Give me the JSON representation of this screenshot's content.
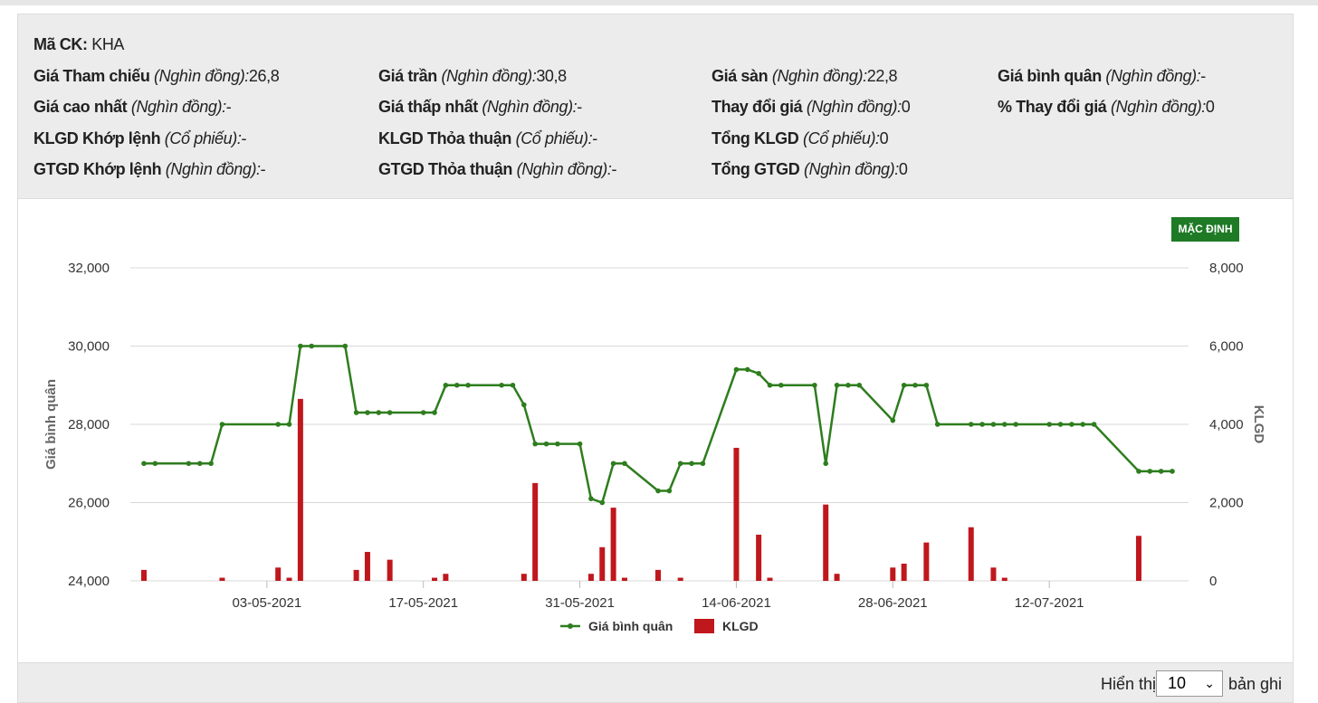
{
  "info": {
    "ticker_label": "Mã CK:",
    "ticker": "KHA",
    "rows": [
      [
        {
          "label": "Giá Tham chiếu",
          "unit": "(Nghìn đồng):",
          "value": "26,8"
        },
        {
          "label": "Giá trần",
          "unit": "(Nghìn đồng):",
          "value": "30,8"
        },
        {
          "label": "Giá sàn",
          "unit": "(Nghìn đồng):",
          "value": "22,8"
        },
        {
          "label": "Giá bình quân",
          "unit": "(Nghìn đồng):",
          "value": "-"
        }
      ],
      [
        {
          "label": "Giá cao nhất",
          "unit": "(Nghìn đồng):",
          "value": "-"
        },
        {
          "label": "Giá thấp nhất",
          "unit": "(Nghìn đồng):",
          "value": "-"
        },
        {
          "label": "Thay đổi giá",
          "unit": "(Nghìn đồng):",
          "value": "0"
        },
        {
          "label": "% Thay đổi giá",
          "unit": "(Nghìn đồng):",
          "value": "0"
        }
      ],
      [
        {
          "label": "KLGD Khớp lệnh",
          "unit": "(Cổ phiếu):",
          "value": "-"
        },
        {
          "label": "KLGD Thỏa thuận",
          "unit": "(Cổ phiếu):",
          "value": "-"
        },
        {
          "label": "Tổng KLGD",
          "unit": "(Cổ phiếu):",
          "value": "0"
        }
      ],
      [
        {
          "label": "GTGD Khớp lệnh",
          "unit": "(Nghìn đồng):",
          "value": "-"
        },
        {
          "label": "GTGD Thỏa thuận",
          "unit": "(Nghìn đồng):",
          "value": "-"
        },
        {
          "label": "Tổng GTGD",
          "unit": "(Nghìn đồng):",
          "value": "0"
        }
      ]
    ]
  },
  "default_button": "MẶC ĐỊNH",
  "footer": {
    "show_label": "Hiển thị",
    "page_size": "10",
    "records_label": "bản ghi"
  },
  "chart_data": {
    "type": "line+bar",
    "ylabel_left": "Giá bình quân",
    "ylabel_right": "KLGD",
    "y_left_range": [
      24000,
      32000
    ],
    "y_left_ticks": [
      "24,000",
      "26,000",
      "28,000",
      "30,000",
      "32,000"
    ],
    "y_right_range": [
      0,
      8000
    ],
    "y_right_ticks": [
      "0",
      "2,000",
      "4,000",
      "6,000",
      "8,000"
    ],
    "x_tick_labels": [
      {
        "index": 11,
        "label": "03-05-2021"
      },
      {
        "index": 25,
        "label": "17-05-2021"
      },
      {
        "index": 39,
        "label": "31-05-2021"
      },
      {
        "index": 53,
        "label": "14-06-2021"
      },
      {
        "index": 67,
        "label": "28-06-2021"
      },
      {
        "index": 81,
        "label": "12-07-2021"
      }
    ],
    "n_days": 92,
    "legend": [
      "Giá bình quân",
      "KLGD"
    ],
    "colors": {
      "line": "#2e7d1e",
      "bar": "#c0171d"
    },
    "price_points": [
      [
        0,
        27000
      ],
      [
        1,
        27000
      ],
      [
        4,
        27000
      ],
      [
        5,
        27000
      ],
      [
        6,
        27000
      ],
      [
        7,
        28000
      ],
      [
        12,
        28000
      ],
      [
        13,
        28000
      ],
      [
        14,
        30000
      ],
      [
        15,
        30000
      ],
      [
        18,
        30000
      ],
      [
        19,
        28300
      ],
      [
        20,
        28300
      ],
      [
        21,
        28300
      ],
      [
        22,
        28300
      ],
      [
        25,
        28300
      ],
      [
        26,
        28300
      ],
      [
        27,
        29000
      ],
      [
        28,
        29000
      ],
      [
        29,
        29000
      ],
      [
        32,
        29000
      ],
      [
        33,
        29000
      ],
      [
        34,
        28500
      ],
      [
        35,
        27500
      ],
      [
        36,
        27500
      ],
      [
        37,
        27500
      ],
      [
        39,
        27500
      ],
      [
        40,
        26100
      ],
      [
        41,
        26000
      ],
      [
        42,
        27000
      ],
      [
        43,
        27000
      ],
      [
        46,
        26300
      ],
      [
        47,
        26300
      ],
      [
        48,
        27000
      ],
      [
        49,
        27000
      ],
      [
        50,
        27000
      ],
      [
        53,
        29400
      ],
      [
        54,
        29400
      ],
      [
        55,
        29300
      ],
      [
        56,
        29000
      ],
      [
        57,
        29000
      ],
      [
        60,
        29000
      ],
      [
        61,
        27000
      ],
      [
        62,
        29000
      ],
      [
        63,
        29000
      ],
      [
        64,
        29000
      ],
      [
        67,
        28100
      ],
      [
        68,
        29000
      ],
      [
        69,
        29000
      ],
      [
        70,
        29000
      ],
      [
        71,
        28000
      ],
      [
        74,
        28000
      ],
      [
        75,
        28000
      ],
      [
        76,
        28000
      ],
      [
        77,
        28000
      ],
      [
        78,
        28000
      ],
      [
        81,
        28000
      ],
      [
        82,
        28000
      ],
      [
        83,
        28000
      ],
      [
        84,
        28000
      ],
      [
        85,
        28000
      ],
      [
        89,
        26800
      ],
      [
        90,
        26800
      ],
      [
        91,
        26800
      ],
      [
        92,
        26800
      ]
    ],
    "volume_bars": [
      [
        0,
        280
      ],
      [
        7,
        80
      ],
      [
        12,
        340
      ],
      [
        13,
        80
      ],
      [
        14,
        4650
      ],
      [
        19,
        280
      ],
      [
        20,
        740
      ],
      [
        22,
        540
      ],
      [
        26,
        80
      ],
      [
        27,
        180
      ],
      [
        34,
        180
      ],
      [
        35,
        2500
      ],
      [
        40,
        180
      ],
      [
        41,
        860
      ],
      [
        42,
        1870
      ],
      [
        43,
        80
      ],
      [
        46,
        280
      ],
      [
        48,
        80
      ],
      [
        53,
        3400
      ],
      [
        55,
        1180
      ],
      [
        56,
        80
      ],
      [
        61,
        1950
      ],
      [
        62,
        180
      ],
      [
        67,
        340
      ],
      [
        68,
        440
      ],
      [
        70,
        980
      ],
      [
        74,
        1370
      ],
      [
        76,
        340
      ],
      [
        77,
        80
      ],
      [
        89,
        1150
      ]
    ]
  }
}
